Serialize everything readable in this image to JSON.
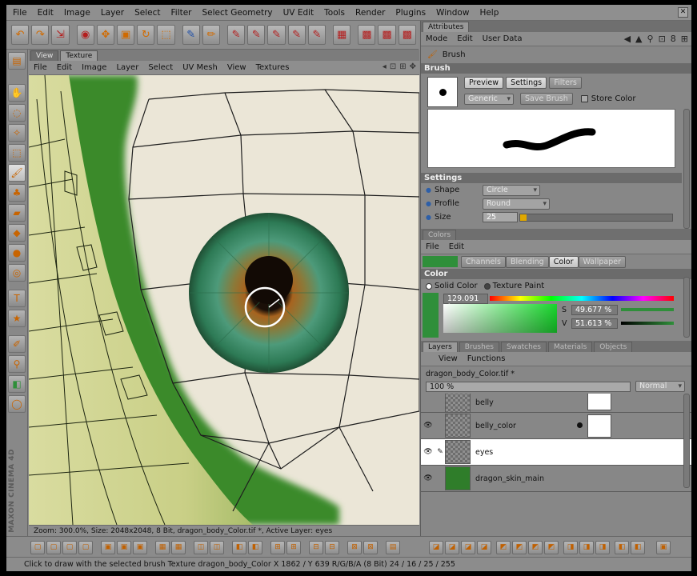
{
  "menubar": [
    "File",
    "Edit",
    "Image",
    "Layer",
    "Select",
    "Filter",
    "Select Geometry",
    "UV Edit",
    "Tools",
    "Render",
    "Plugins",
    "Window",
    "Help"
  ],
  "view": {
    "tabs": [
      "View",
      "Texture"
    ],
    "menu": [
      "File",
      "Edit",
      "Image",
      "Layer",
      "Select",
      "UV Mesh",
      "View",
      "Textures"
    ],
    "status": "Zoom: 300.0%, Size: 2048x2048, 8 Bit, dragon_body_Color.tif *, Active Layer: eyes"
  },
  "attributes": {
    "tab": "Attributes",
    "menu": [
      "Mode",
      "Edit",
      "User Data"
    ],
    "object": "Brush",
    "section": "Brush",
    "subtabs": [
      "Preview",
      "Settings",
      "Filters"
    ],
    "preset": "Generic",
    "save_brush": "Save Brush",
    "store_color": "Store Color",
    "settings_title": "Settings",
    "shape": {
      "label": "Shape",
      "value": "Circle"
    },
    "profile": {
      "label": "Profile",
      "value": "Round"
    },
    "size": {
      "label": "Size",
      "value": "25",
      "fill": 0.04
    }
  },
  "colors": {
    "tab": "Colors",
    "menu": [
      "File",
      "Edit"
    ],
    "subtabs": [
      "Channels",
      "Blending",
      "Color",
      "Wallpaper"
    ],
    "section": "Color",
    "solid": "Solid Color",
    "texture": "Texture Paint",
    "h_value": "129.091 °",
    "s_label": "S",
    "s_value": "49.677 %",
    "v_label": "V",
    "v_value": "51.613 %",
    "swatch": "#2f8f3a"
  },
  "layers": {
    "tabs": [
      "Layers",
      "Brushes",
      "Swatches",
      "Materials",
      "Objects"
    ],
    "menu": [
      "View",
      "Functions"
    ],
    "file": "dragon_body_Color.tif *",
    "opacity": "100 %",
    "mode": "Normal",
    "items": [
      {
        "name": "belly"
      },
      {
        "name": "belly_color"
      },
      {
        "name": "eyes"
      },
      {
        "name": "dragon_skin_main"
      }
    ]
  },
  "help": "Click to draw with the selected brush   Texture dragon_body_Color   X 1862 / Y 639 R/G/B/A (8 Bit) 24 / 16 / 25 / 255",
  "colors_accent": {
    "highlight": "#ffffff",
    "green": "#2f8f3a"
  }
}
